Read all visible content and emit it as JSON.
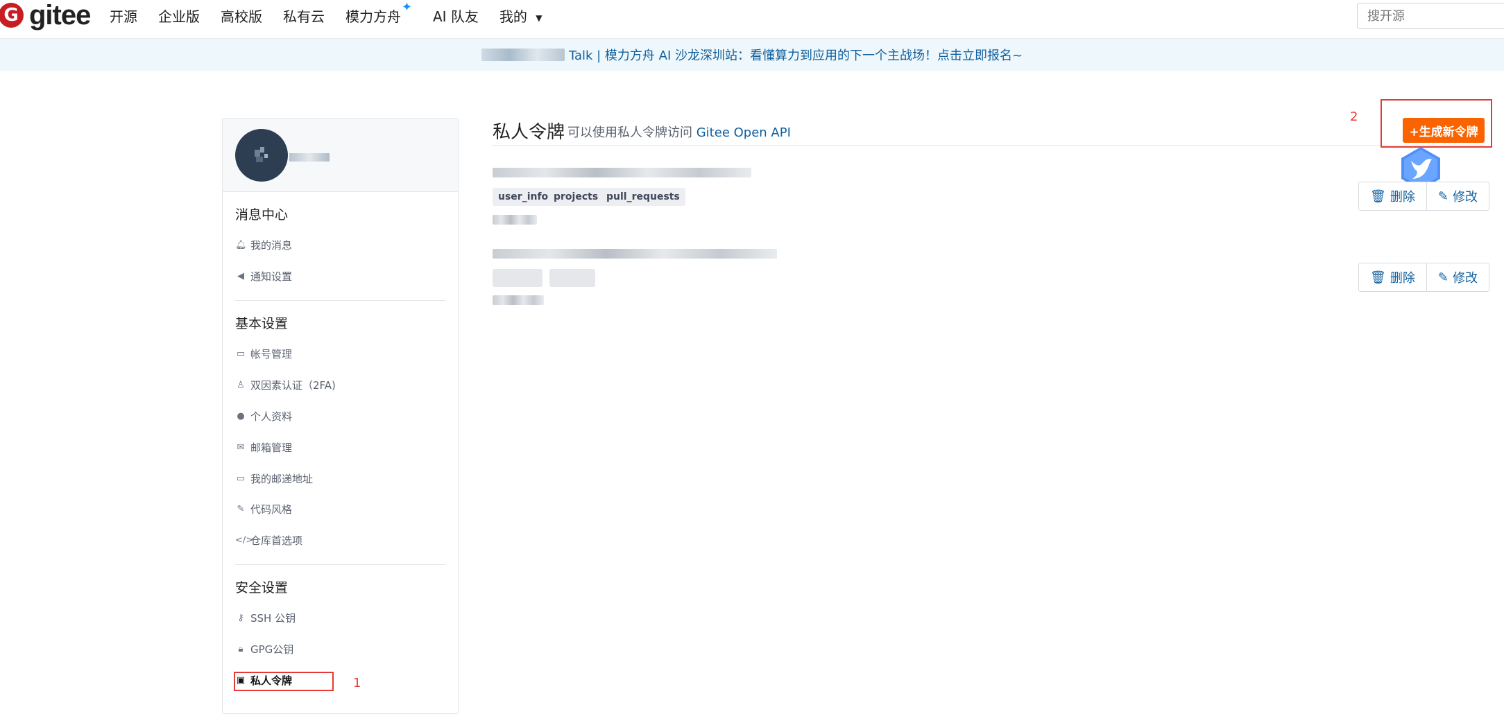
{
  "header": {
    "logo_text": "gitee",
    "logo_mark": "G",
    "nav": [
      {
        "label": "开源"
      },
      {
        "label": "企业版"
      },
      {
        "label": "高校版"
      },
      {
        "label": "私有云"
      },
      {
        "label": "模力方舟"
      },
      {
        "label": "AI 队友"
      },
      {
        "label": "我的"
      }
    ],
    "search_placeholder": "搜开源"
  },
  "banner": {
    "text": "Talk | 模力方舟 AI 沙龙深圳站：看懂算力到应用的下一个主战场！点击立即报名~"
  },
  "sidebar": {
    "sections": [
      {
        "title": "消息中心",
        "items": [
          {
            "label": "我的消息",
            "icon": "bell-icon"
          },
          {
            "label": "通知设置",
            "icon": "speaker-icon"
          }
        ]
      },
      {
        "title": "基本设置",
        "items": [
          {
            "label": "帐号管理",
            "icon": "id-card-icon"
          },
          {
            "label": "双因素认证（2FA)",
            "icon": "user-key-icon"
          },
          {
            "label": "个人资料",
            "icon": "user-icon"
          },
          {
            "label": "邮箱管理",
            "icon": "envelope-icon"
          },
          {
            "label": "我的邮递地址",
            "icon": "address-card-icon"
          },
          {
            "label": "代码风格",
            "icon": "brush-icon"
          },
          {
            "label": "仓库首选项",
            "icon": "code-icon"
          }
        ]
      },
      {
        "title": "安全设置",
        "items": [
          {
            "label": "SSH 公钥",
            "icon": "key-icon"
          },
          {
            "label": "GPG公钥",
            "icon": "lock-icon"
          },
          {
            "label": "私人令牌",
            "icon": "token-icon",
            "active": true
          }
        ]
      }
    ]
  },
  "main": {
    "title": "私人令牌",
    "subtitle_prefix": "可以使用私人令牌访问",
    "subtitle_link": "Gitee Open API",
    "generate_button": "+生成新令牌",
    "tokens": [
      {
        "scopes": [
          "user_info",
          "projects",
          "pull_requests"
        ],
        "delete_label": "删除",
        "edit_label": "修改"
      },
      {
        "scopes": [],
        "delete_label": "删除",
        "edit_label": "修改"
      }
    ]
  },
  "annotations": {
    "box1_number": "1",
    "box2_number": "2"
  },
  "colors": {
    "brand": "#c71d23",
    "accent_orange": "#fa6400",
    "link": "#0f5f9e",
    "annotation_red": "#e53935"
  }
}
